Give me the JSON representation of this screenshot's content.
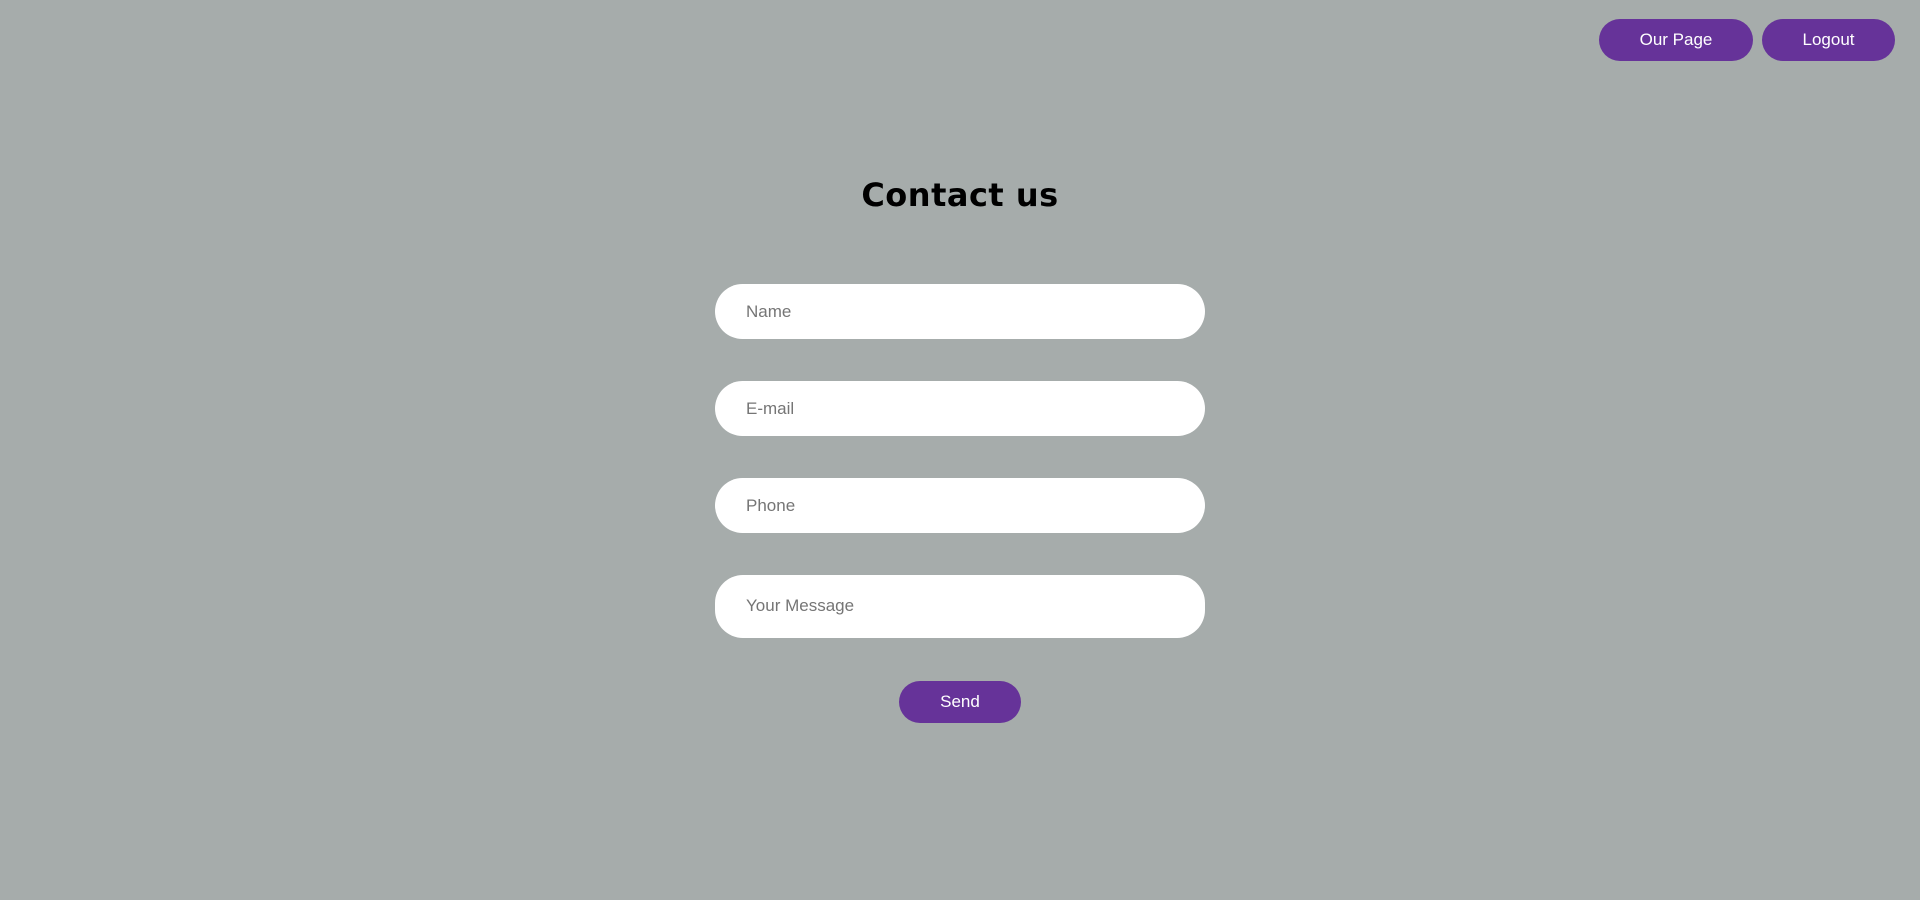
{
  "nav": {
    "our_page_label": "Our Page",
    "logout_label": "Logout"
  },
  "page_title": "Contact us",
  "form": {
    "name_placeholder": "Name",
    "email_placeholder": "E-mail",
    "phone_placeholder": "Phone",
    "message_placeholder": "Your Message",
    "name_value": "",
    "email_value": "",
    "phone_value": "",
    "message_value": "",
    "send_label": "Send"
  },
  "colors": {
    "background": "#a6acab",
    "accent": "#663399",
    "field_background": "#ffffff"
  }
}
